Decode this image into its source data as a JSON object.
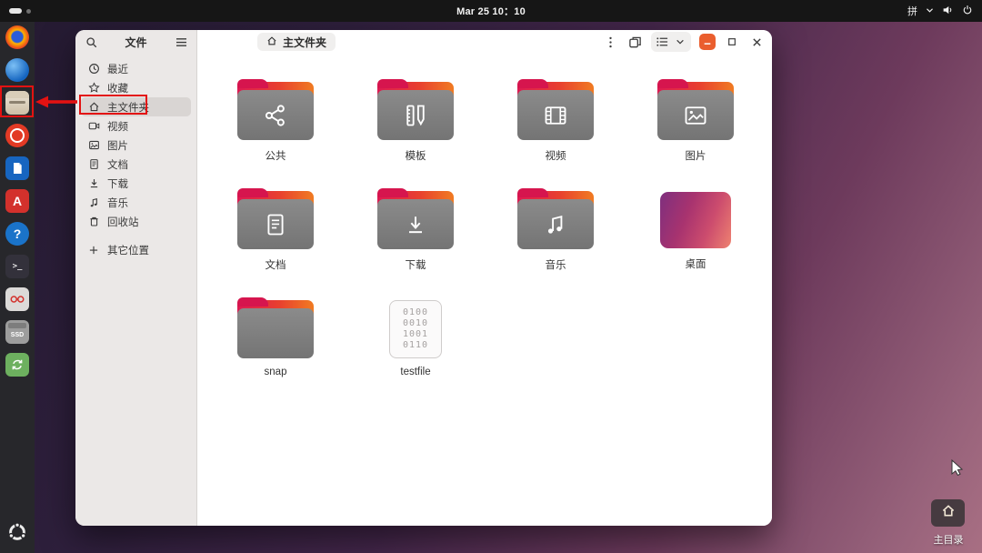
{
  "topbar": {
    "clock": "Mar 25 10：10",
    "ime_label": "拼"
  },
  "dock": {
    "app_a_letter": "A",
    "help_glyph": "?",
    "terminal_glyph": "&gt;_",
    "ssd_label": "SSD"
  },
  "window": {
    "sidebar": {
      "title": "文件",
      "items": [
        {
          "label": "最近"
        },
        {
          "label": "收藏"
        },
        {
          "label": "主文件夹"
        },
        {
          "label": "视频"
        },
        {
          "label": "图片"
        },
        {
          "label": "文档"
        },
        {
          "label": "下载"
        },
        {
          "label": "音乐"
        },
        {
          "label": "回收站"
        }
      ],
      "other_locations": "其它位置"
    },
    "header": {
      "breadcrumb": "主文件夹"
    },
    "grid": {
      "items": [
        {
          "label": "公共"
        },
        {
          "label": "模板"
        },
        {
          "label": "视频"
        },
        {
          "label": "图片"
        },
        {
          "label": "文档"
        },
        {
          "label": "下载"
        },
        {
          "label": "音乐"
        },
        {
          "label": "桌面"
        },
        {
          "label": "snap"
        },
        {
          "label": "testfile",
          "preview": "0100\n0010\n1001\n0110"
        }
      ]
    }
  },
  "desktop": {
    "home_label": "主目录"
  },
  "colors": {
    "accent_orange": "#e95420",
    "annotation_red": "#e31212",
    "folder_gray": "#7f7f7f"
  }
}
